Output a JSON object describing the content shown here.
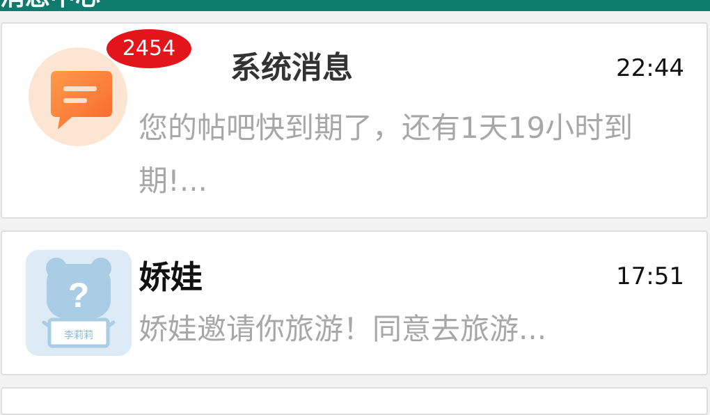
{
  "header": {
    "title": "消息中心"
  },
  "conversations": [
    {
      "title": "系统消息",
      "time": "22:44",
      "preview": "您的帖吧快到期了，还有1天19小时到期!...",
      "badge": "2454",
      "avatar_icon": "chat-bubble-icon",
      "avatar_color": "#fd7e3a"
    },
    {
      "title": "娇娃",
      "time": "17:51",
      "preview": "娇娃邀请你旅游！同意去旅游...",
      "avatar_icon": "placeholder-bear-icon",
      "avatar_caption": "李莉莉",
      "avatar_color": "#a9cde4"
    }
  ]
}
